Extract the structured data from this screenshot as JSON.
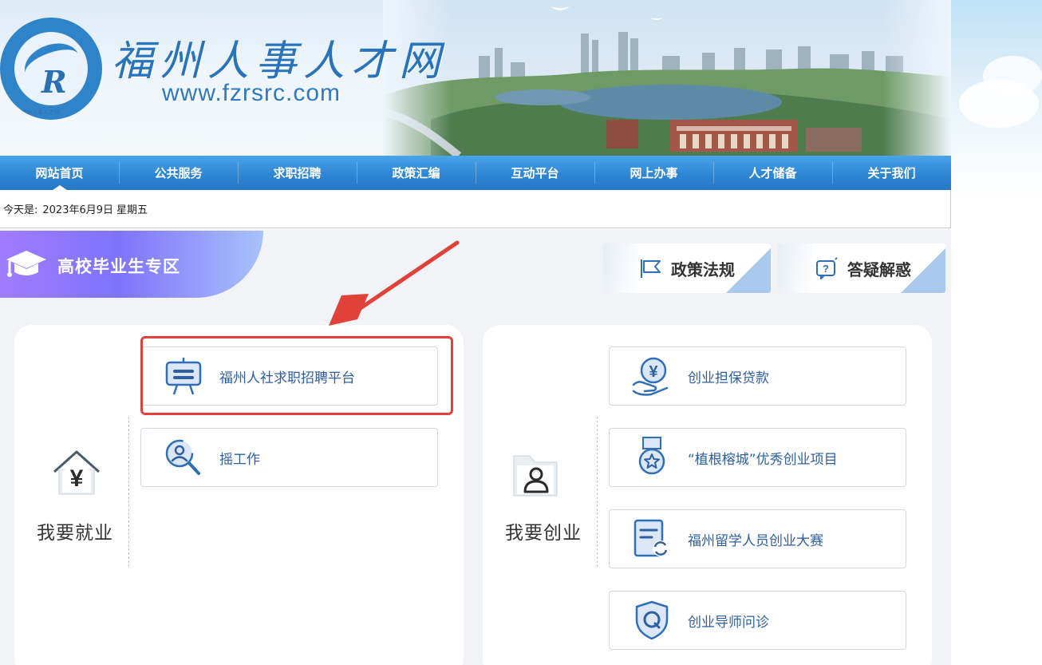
{
  "header": {
    "site_title": "福州人事人才网",
    "site_url": "www.fzrsrc.com",
    "logo_small_text": "福州人事人才网"
  },
  "nav": {
    "items": [
      {
        "label": "网站首页"
      },
      {
        "label": "公共服务"
      },
      {
        "label": "求职招聘"
      },
      {
        "label": "政策汇编"
      },
      {
        "label": "互动平台"
      },
      {
        "label": "网上办事"
      },
      {
        "label": "人才储备"
      },
      {
        "label": "关于我们"
      }
    ],
    "active_index": 0
  },
  "datebar": {
    "prefix": "今天是:",
    "date": "2023年6月9日",
    "weekday": "星期五"
  },
  "section": {
    "banner_title": "高校毕业生专区",
    "tab_policy": "政策法规",
    "tab_faq": "答疑解惑"
  },
  "employment": {
    "label": "我要就业",
    "items": [
      {
        "label": "福州人社求职招聘平台",
        "icon": "easel-icon"
      },
      {
        "label": "摇工作",
        "icon": "search-user-icon"
      }
    ]
  },
  "entrepreneurship": {
    "label": "我要创业",
    "items": [
      {
        "label": "创业担保贷款",
        "icon": "yuan-hand-icon"
      },
      {
        "label": "“植根榕城”优秀创业项目",
        "icon": "medal-icon"
      },
      {
        "label": "福州留学人员创业大赛",
        "icon": "document-refresh-icon"
      },
      {
        "label": "创业导师问诊",
        "icon": "shield-q-icon"
      }
    ]
  },
  "colors": {
    "nav_blue": "#2f86d3",
    "item_text": "#2e5fa3",
    "highlight_red": "#e0423a",
    "banner_purple": "#7f73fb"
  }
}
